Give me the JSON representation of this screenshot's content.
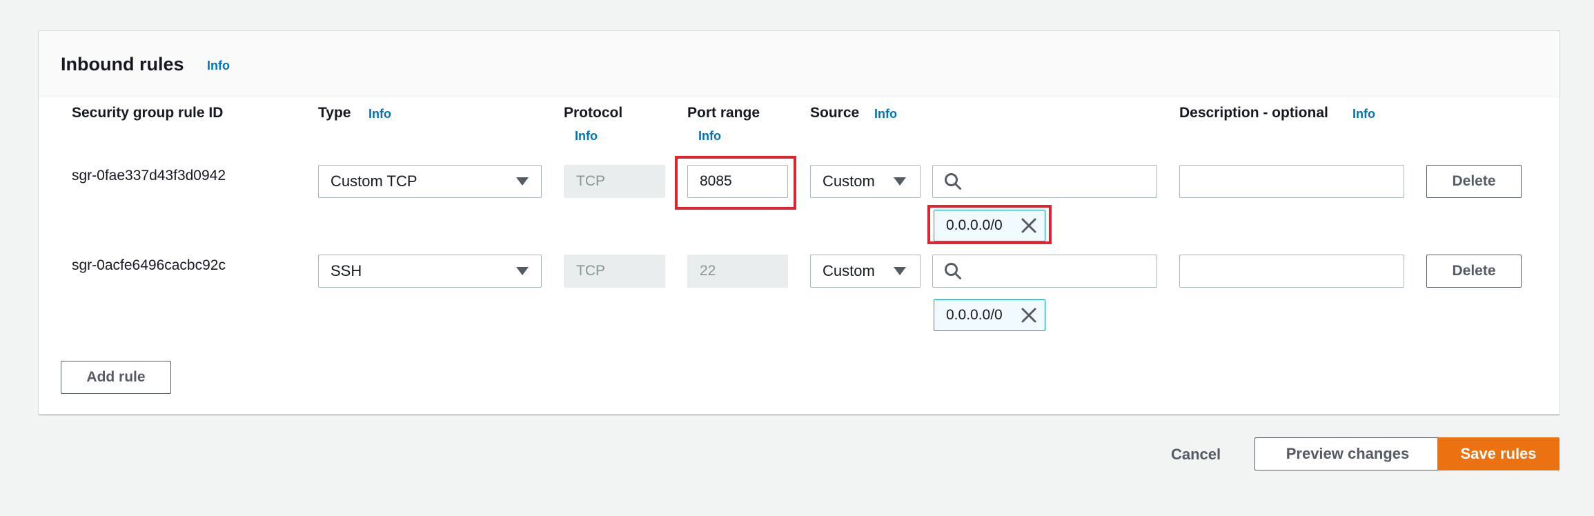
{
  "panel": {
    "title": "Inbound rules",
    "info_label": "Info"
  },
  "columns": {
    "rule_id": "Security group rule ID",
    "type": "Type",
    "protocol": "Protocol",
    "port_range": "Port range",
    "source": "Source",
    "description": "Description - optional",
    "info": "Info"
  },
  "rules": [
    {
      "id": "sgr-0fae337d43f3d0942",
      "type": "Custom TCP",
      "protocol": "TCP",
      "port_range": "8085",
      "source_type": "Custom",
      "source_search": "",
      "source_token": "0.0.0.0/0",
      "description": "",
      "delete_label": "Delete"
    },
    {
      "id": "sgr-0acfe6496cacbc92c",
      "type": "SSH",
      "protocol": "TCP",
      "port_range": "22",
      "source_type": "Custom",
      "source_search": "",
      "source_token": "0.0.0.0/0",
      "description": "",
      "delete_label": "Delete"
    }
  ],
  "add_rule_label": "Add rule",
  "footer": {
    "cancel": "Cancel",
    "preview": "Preview changes",
    "save": "Save rules"
  },
  "colors": {
    "primary": "#ec7211",
    "link": "#0073bb",
    "token_border": "#00a1c9",
    "highlight": "#e0232e"
  }
}
